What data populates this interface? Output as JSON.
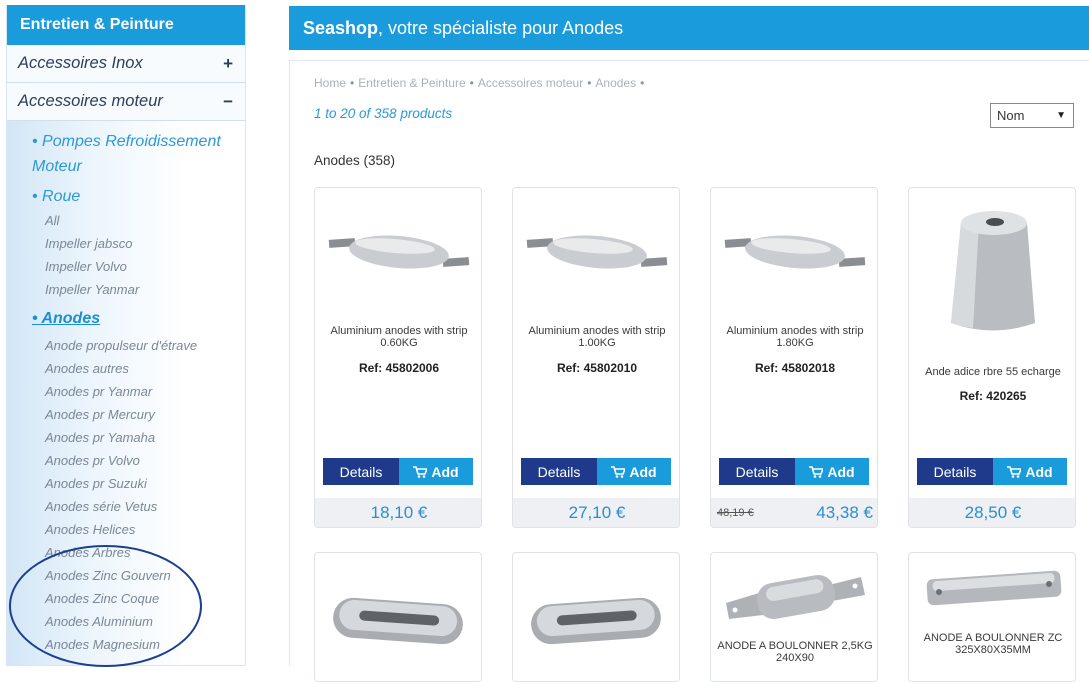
{
  "sidebar": {
    "header": "Entretien & Peinture",
    "rows": [
      {
        "label": "Accessoires Inox",
        "sign": "+"
      },
      {
        "label": "Accessoires moteur",
        "sign": "−"
      }
    ],
    "cat_pompes": "• Pompes Refroidissement Moteur",
    "cat_roue": "• Roue",
    "roue_items": [
      "All",
      "Impeller jabsco",
      "Impeller Volvo",
      "Impeller Yanmar"
    ],
    "cat_anodes": "• Anodes",
    "anodes_items": [
      "Anode propulseur d'étrave",
      "Anodes autres",
      "Anodes pr Yanmar",
      "Anodes pr Mercury",
      "Anodes pr Yamaha",
      "Anodes pr Volvo",
      "Anodes pr Suzuki",
      "Anodes série Vetus",
      "Anodes Helices",
      "Anodes Arbres",
      "Anodes Zinc Gouvern",
      "Anodes Zinc Coque",
      "Anodes Aluminium",
      "Anodes Magnesium"
    ]
  },
  "banner": {
    "brand": "Seashop",
    "rest": ", votre spécialiste pour Anodes"
  },
  "breadcrumb": [
    "Home",
    "Entretien & Peinture",
    "Accessoires moteur",
    "Anodes"
  ],
  "product_count": "1 to 20 of 358 products",
  "sort": {
    "selected": "Nom"
  },
  "category_heading": "Anodes (358)",
  "buttons": {
    "details": "Details",
    "add": "Add"
  },
  "products": [
    {
      "name": "Aluminium anodes with strip 0.60KG",
      "ref": "Ref: 45802006",
      "price": "18,10 €",
      "old_price": ""
    },
    {
      "name": "Aluminium anodes with strip 1.00KG",
      "ref": "Ref: 45802010",
      "price": "27,10 €",
      "old_price": ""
    },
    {
      "name": "Aluminium anodes with strip 1.80KG",
      "ref": "Ref: 45802018",
      "price": "43,38 €",
      "old_price": "48,19 €"
    },
    {
      "name": "Ande adice rbre 55 echarge",
      "ref": "Ref: 420265",
      "price": "28,50 €",
      "old_price": ""
    },
    {
      "name": "",
      "ref": "",
      "price": "",
      "old_price": ""
    },
    {
      "name": "",
      "ref": "",
      "price": "",
      "old_price": ""
    },
    {
      "name": "ANODE A BOULONNER 2,5KG 240X90",
      "ref": "",
      "price": "",
      "old_price": ""
    },
    {
      "name": "ANODE A BOULONNER ZC 325X80X35MM",
      "ref": "",
      "price": "",
      "old_price": ""
    }
  ],
  "colors": {
    "accent": "#1a9bdb",
    "details_button": "#1f3a8a",
    "link": "#2a9ad6",
    "circle": "#1d3f8f"
  }
}
